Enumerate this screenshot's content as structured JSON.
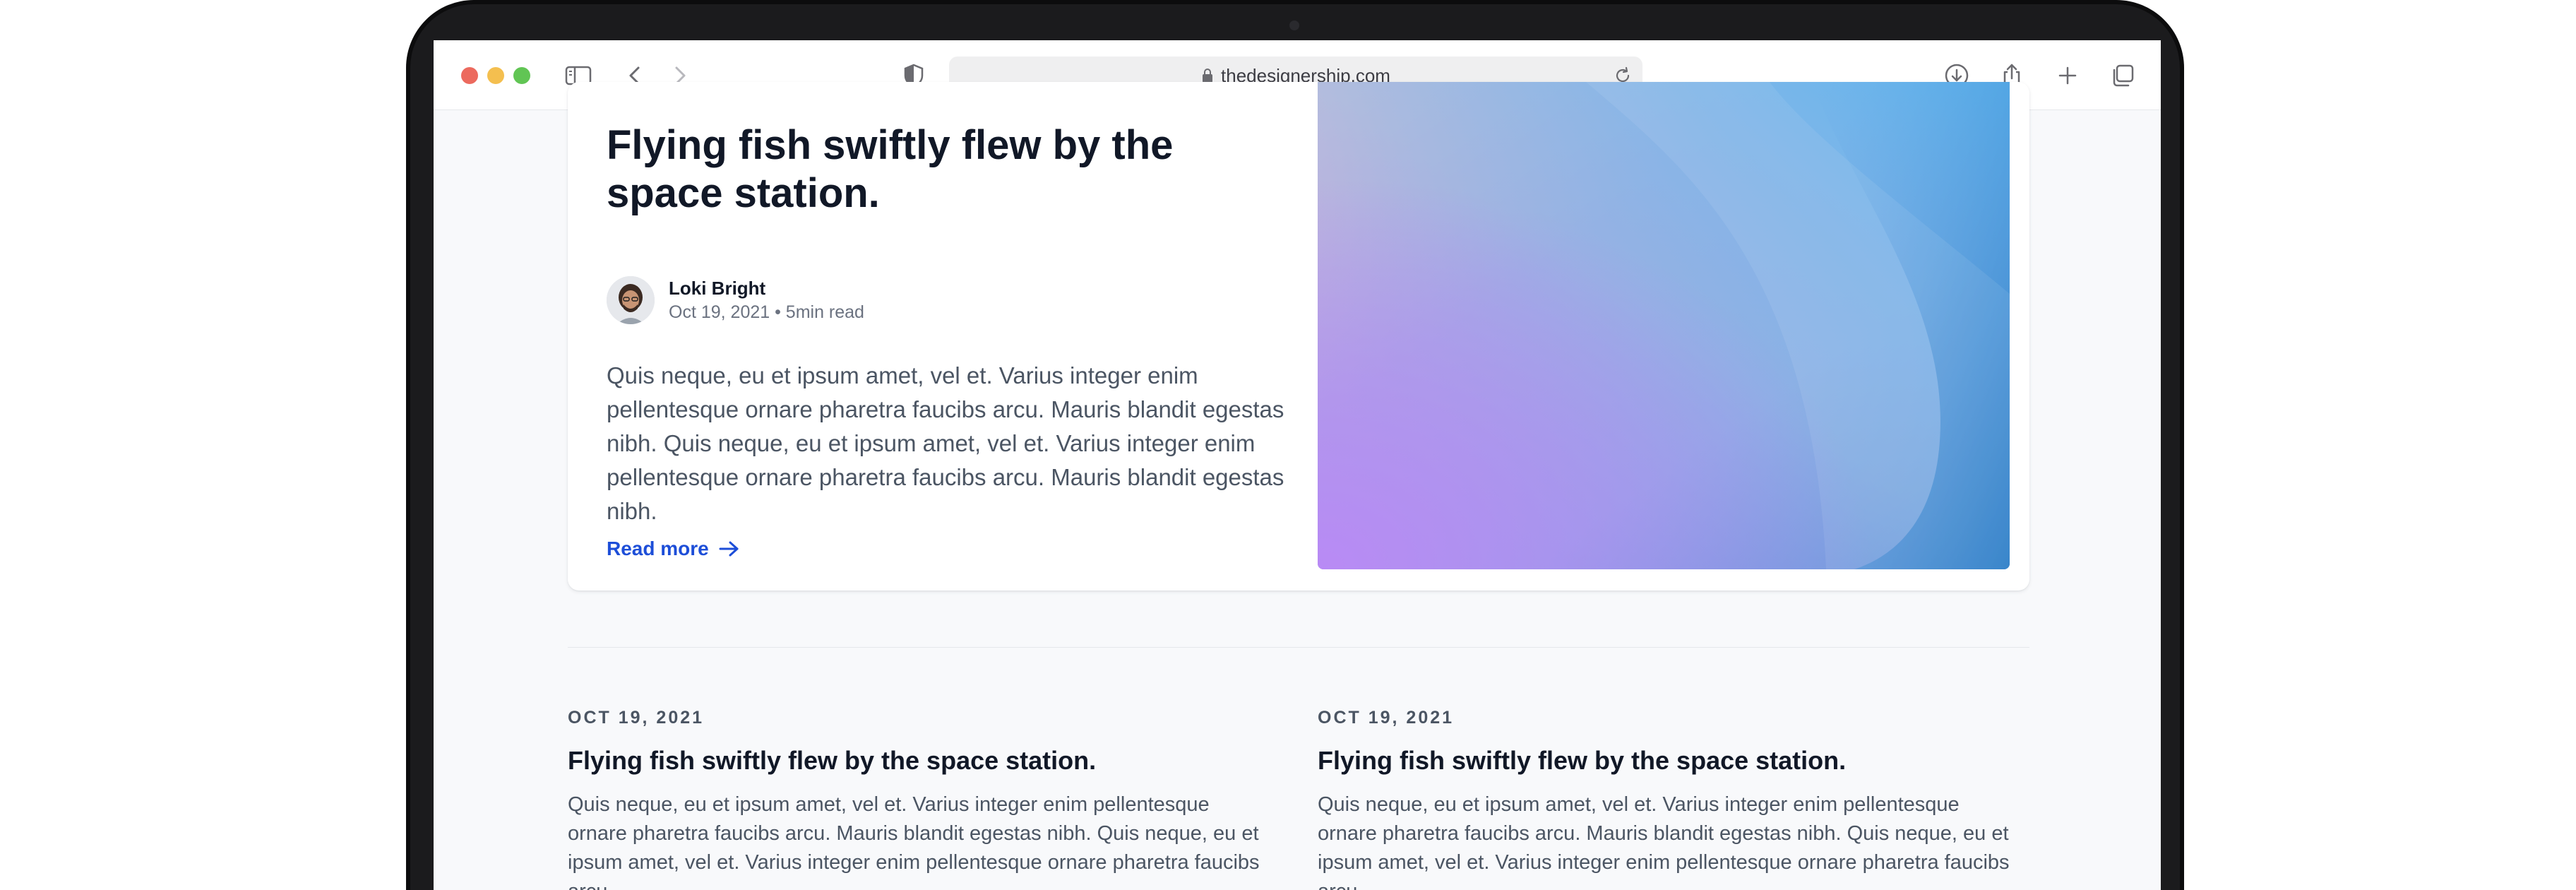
{
  "browser": {
    "url": "thedesignership.com",
    "colors": {
      "close": "#ec6a5e",
      "minimize": "#f4bf4f",
      "zoom": "#61c554"
    },
    "icons": [
      "sidebar-icon",
      "back-icon",
      "forward-icon",
      "privacy-shield-icon",
      "lock-icon",
      "reload-icon",
      "download-icon",
      "share-icon",
      "new-tab-icon",
      "tabs-overview-icon"
    ]
  },
  "featured": {
    "title": "Flying fish swiftly flew by the space station.",
    "author": {
      "name": "Loki Bright",
      "meta": "Oct 19, 2021 • 5min read"
    },
    "body": "Quis neque, eu et ipsum amet, vel et. Varius integer enim pellentesque ornare pharetra faucibs arcu. Mauris blandit egestas nibh. Quis neque, eu et ipsum amet, vel et. Varius integer enim pellentesque ornare pharetra faucibs arcu. Mauris blandit egestas nibh.",
    "read_more": "Read more",
    "accent": "#1d4ed8"
  },
  "posts": [
    {
      "date": "OCT 19, 2021",
      "title": "Flying fish swiftly flew by the space station.",
      "body": "Quis neque, eu et ipsum amet, vel et. Varius integer enim pellentesque ornare pharetra faucibs arcu. Mauris blandit egestas nibh. Quis neque, eu et ipsum amet, vel et. Varius integer enim pellentesque ornare pharetra faucibs arcu."
    },
    {
      "date": "OCT 19, 2021",
      "title": "Flying fish swiftly flew by the space station.",
      "body": "Quis neque, eu et ipsum amet, vel et. Varius integer enim pellentesque ornare pharetra faucibs arcu. Mauris blandit egestas nibh. Quis neque, eu et ipsum amet, vel et. Varius integer enim pellentesque ornare pharetra faucibs arcu."
    }
  ]
}
